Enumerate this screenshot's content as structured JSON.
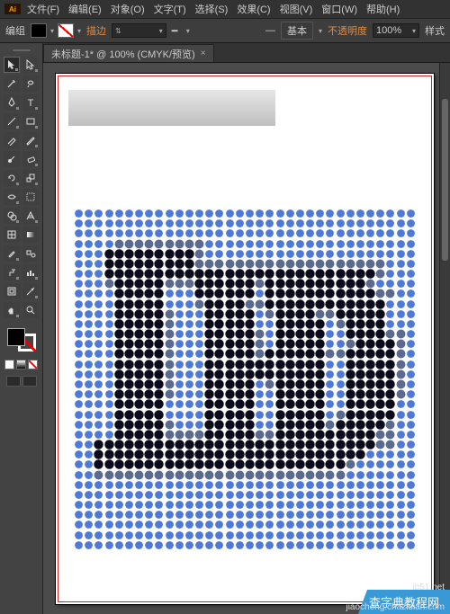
{
  "app": {
    "name": "Adobe Illustrator"
  },
  "menu": {
    "file": "文件(F)",
    "edit": "编辑(E)",
    "object": "对象(O)",
    "type": "文字(T)",
    "select": "选择(S)",
    "effect": "效果(C)",
    "view": "视图(V)",
    "window": "窗口(W)",
    "help": "帮助(H)"
  },
  "control": {
    "mode_label": "编组",
    "stroke_label": "描边",
    "stroke_value": "",
    "style_btn": "基本",
    "opacity_label": "不透明度",
    "opacity_value": "100%",
    "style_label": "样式"
  },
  "tab": {
    "title": "未标题-1* @ 100% (CMYK/预览)"
  },
  "artwork": {
    "text": "LED",
    "grid_size": 34
  },
  "watermark": {
    "main": "查字典教程网",
    "sub": "jiaocheng.chazidian.com",
    "corner": "jb51.net"
  }
}
